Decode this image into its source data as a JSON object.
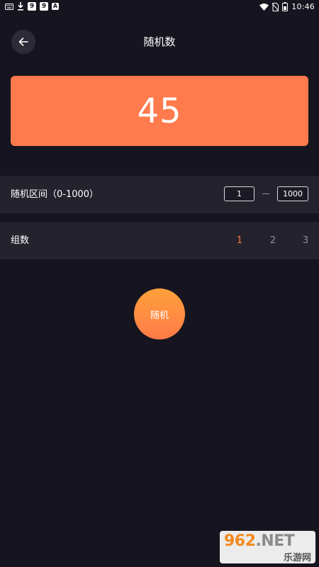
{
  "status_bar": {
    "time": "10:46",
    "left_icons": [
      "keyboard-icon",
      "download-icon",
      "app-9-icon",
      "app-9-icon",
      "app-a-icon"
    ],
    "right_icons": [
      "wifi-icon",
      "no-sim-icon",
      "battery-icon"
    ],
    "app_icon_1": "9",
    "app_icon_2": "9",
    "app_icon_3": "A"
  },
  "header": {
    "title": "随机数",
    "back_icon": "arrow-left-icon"
  },
  "result": {
    "value": "45"
  },
  "range": {
    "label": "随机区间（0-1000）",
    "min_value": "1",
    "max_value": "1000"
  },
  "groups": {
    "label": "组数",
    "options": [
      "1",
      "2",
      "3"
    ],
    "selected": "1"
  },
  "action": {
    "button_label": "随机"
  },
  "watermark": {
    "brand_num": "962",
    "brand_net": ".NET",
    "brand_cn": "乐游网"
  },
  "colors": {
    "background": "#16151f",
    "row_background": "#23222d",
    "accent": "#ff7a4c",
    "button_gradient_top": "#ffa13a",
    "button_gradient_bottom": "#ff7a49",
    "inactive_text": "#8f8e99"
  }
}
